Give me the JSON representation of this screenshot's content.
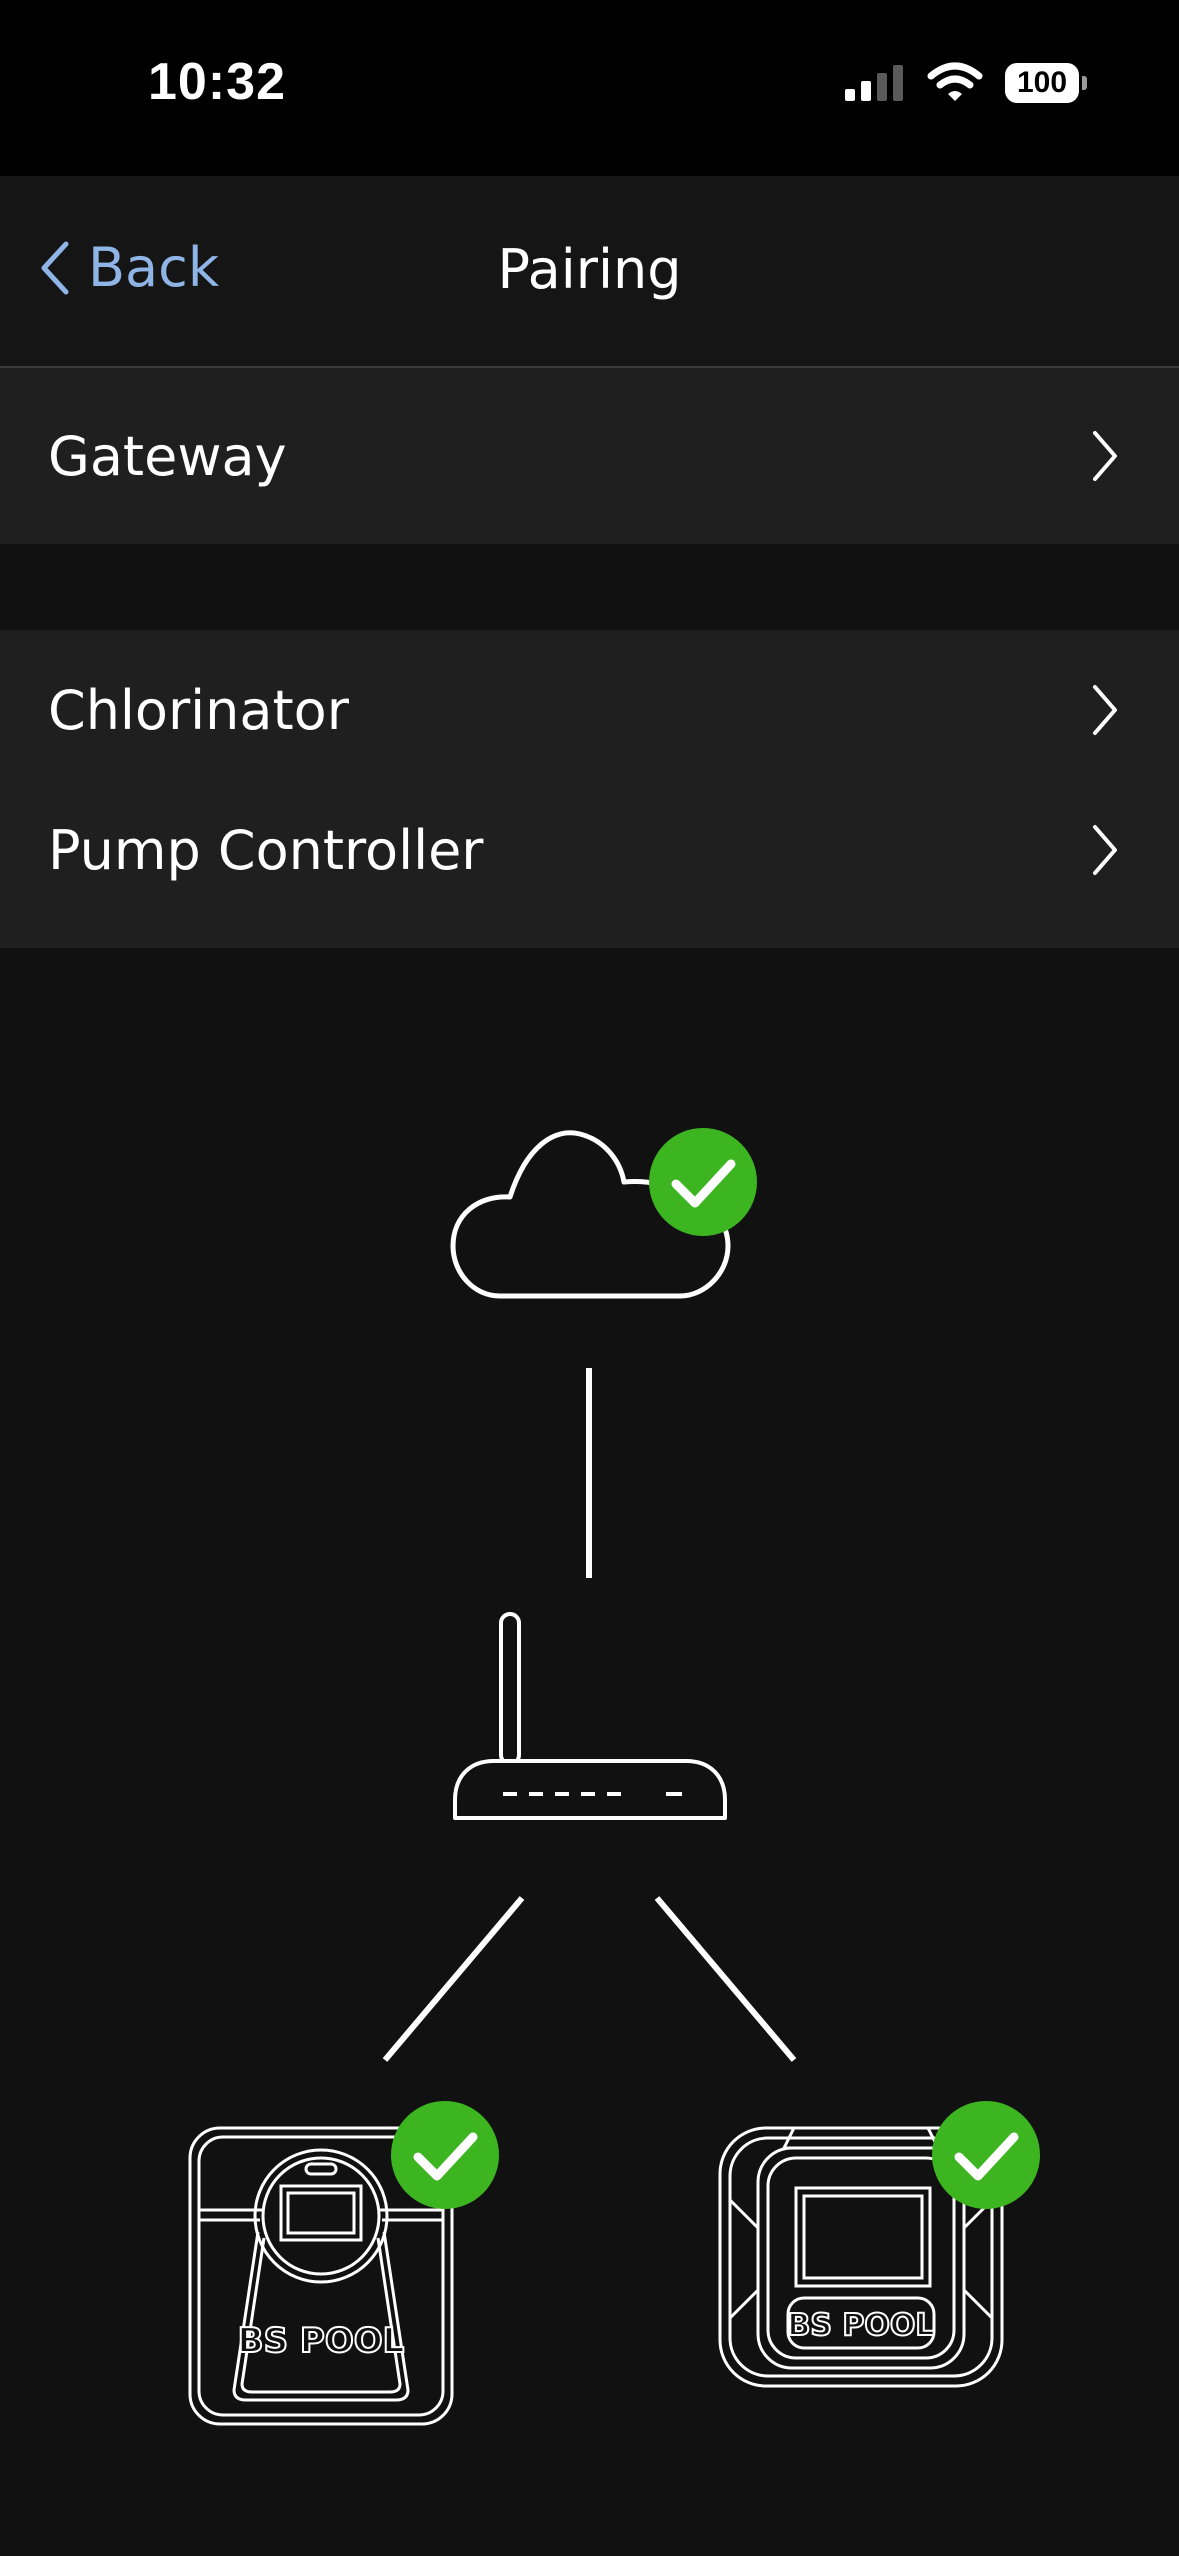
{
  "status_bar": {
    "time": "10:32",
    "battery": "100",
    "icons": [
      "cellular-signal-icon",
      "wifi-icon",
      "battery-icon"
    ]
  },
  "nav": {
    "back_label": "Back",
    "title": "Pairing"
  },
  "menu": {
    "group1": [
      {
        "label": "Gateway"
      }
    ],
    "group2": [
      {
        "label": "Chlorinator"
      },
      {
        "label": "Pump Controller"
      }
    ]
  },
  "diagram": {
    "device_brand_left": "BS POOL",
    "device_brand_right": "BS POOL",
    "icons": [
      "cloud-icon",
      "router-icon",
      "chlorinator-device-icon",
      "pump-controller-device-icon",
      "check-badge-icon"
    ]
  },
  "colors": {
    "background": "#111111",
    "accent_link": "#8fb4e6",
    "success": "#3cb521",
    "row_background": "#1f1f1f"
  }
}
